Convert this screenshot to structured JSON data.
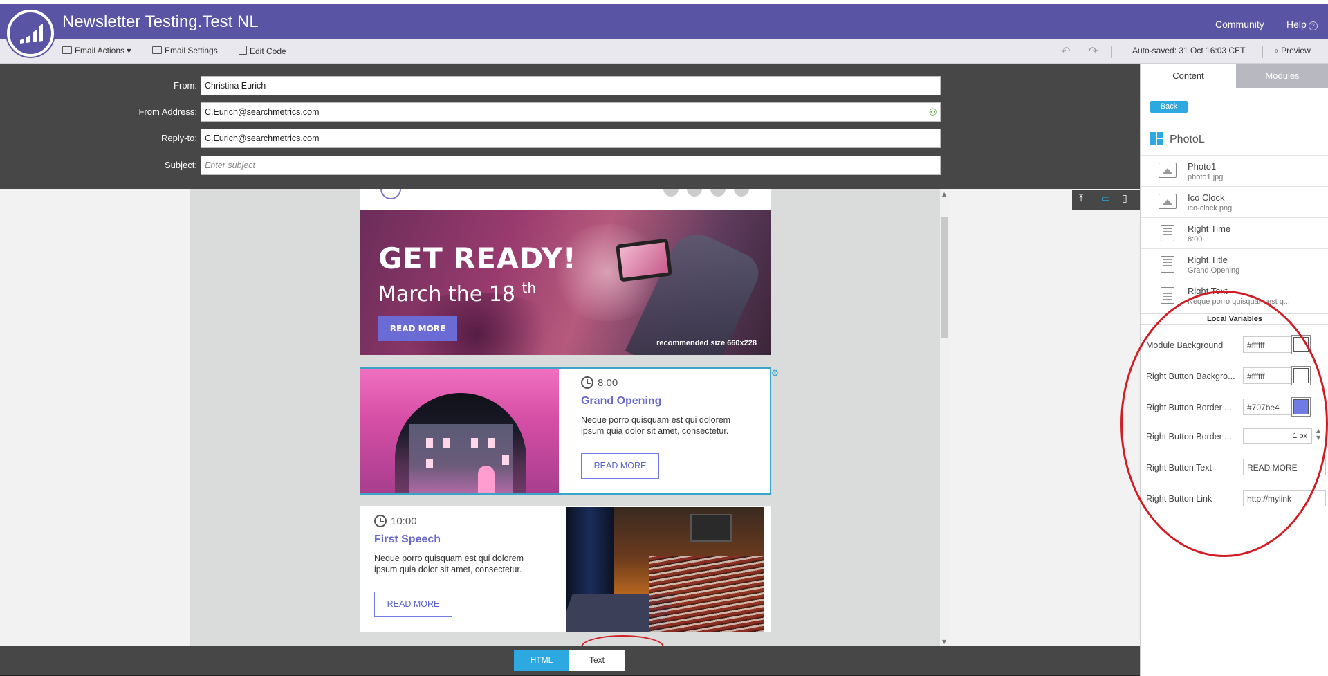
{
  "app": {
    "title": "Newsletter Testing.Test NL",
    "community": "Community",
    "help": "Help"
  },
  "toolbar": {
    "email_actions": "Email Actions",
    "email_settings": "Email Settings",
    "edit_code": "Edit Code",
    "autosaved": "Auto-saved: 31 Oct 16:03 CET",
    "preview": "Preview"
  },
  "header_form": {
    "from_label": "From:",
    "from_value": "Christina Eurich",
    "from_address_label": "From Address:",
    "from_address_value": "C.Eurich@searchmetrics.com",
    "reply_to_label": "Reply-to:",
    "reply_to_value": "C.Eurich@searchmetrics.com",
    "subject_label": "Subject:",
    "subject_placeholder": "Enter subject"
  },
  "email": {
    "hero": {
      "heading": "GET READY!",
      "subheading": "March the 18",
      "superscript": "th",
      "button": "READ MORE",
      "note": "recommended size 660x228"
    },
    "module1": {
      "time": "8:00",
      "title": "Grand Opening",
      "text": "Neque porro quisquam est qui dolorem ipsum quia dolor sit amet, consectetur.",
      "button": "READ MORE"
    },
    "module2": {
      "time": "10:00",
      "title": "First Speech",
      "text": "Neque porro quisquam est qui dolorem ipsum quia dolor sit amet, consectetur.",
      "button": "READ MORE"
    }
  },
  "bottom_tabs": {
    "html": "HTML",
    "text": "Text"
  },
  "right_panel": {
    "tab_content": "Content",
    "tab_modules": "Modules",
    "back": "Back",
    "module_name": "PhotoL",
    "elements": [
      {
        "name": "Photo1",
        "value": "photo1.jpg",
        "icon": "image-icon"
      },
      {
        "name": "Ico Clock",
        "value": "ico-clock.png",
        "icon": "image-icon"
      },
      {
        "name": "Right Time",
        "value": "8:00",
        "icon": "text-icon"
      },
      {
        "name": "Right Title",
        "value": "Grand Opening",
        "icon": "text-icon"
      },
      {
        "name": "Right Text",
        "value": "Neque porro quisquam est q...",
        "icon": "text-icon"
      }
    ],
    "local_variables_header": "Local Variables",
    "variables": {
      "module_background": {
        "label": "Module Background",
        "value": "#ffffff"
      },
      "right_button_background": {
        "label": "Right Button Backgro...",
        "value": "#ffffff"
      },
      "right_button_border_color": {
        "label": "Right Button Border ...",
        "value": "#707be4"
      },
      "right_button_border_width": {
        "label": "Right Button Border ...",
        "value": "1",
        "unit": "px"
      },
      "right_button_text": {
        "label": "Right Button Text",
        "value": "READ MORE"
      },
      "right_button_link": {
        "label": "Right Button Link",
        "value": "http://mylink"
      }
    }
  },
  "colors": {
    "brand_purple": "#5a54a4",
    "accent_blue": "#2da8e1",
    "button_border": "#707be4",
    "annotation_red": "#d21d26"
  }
}
